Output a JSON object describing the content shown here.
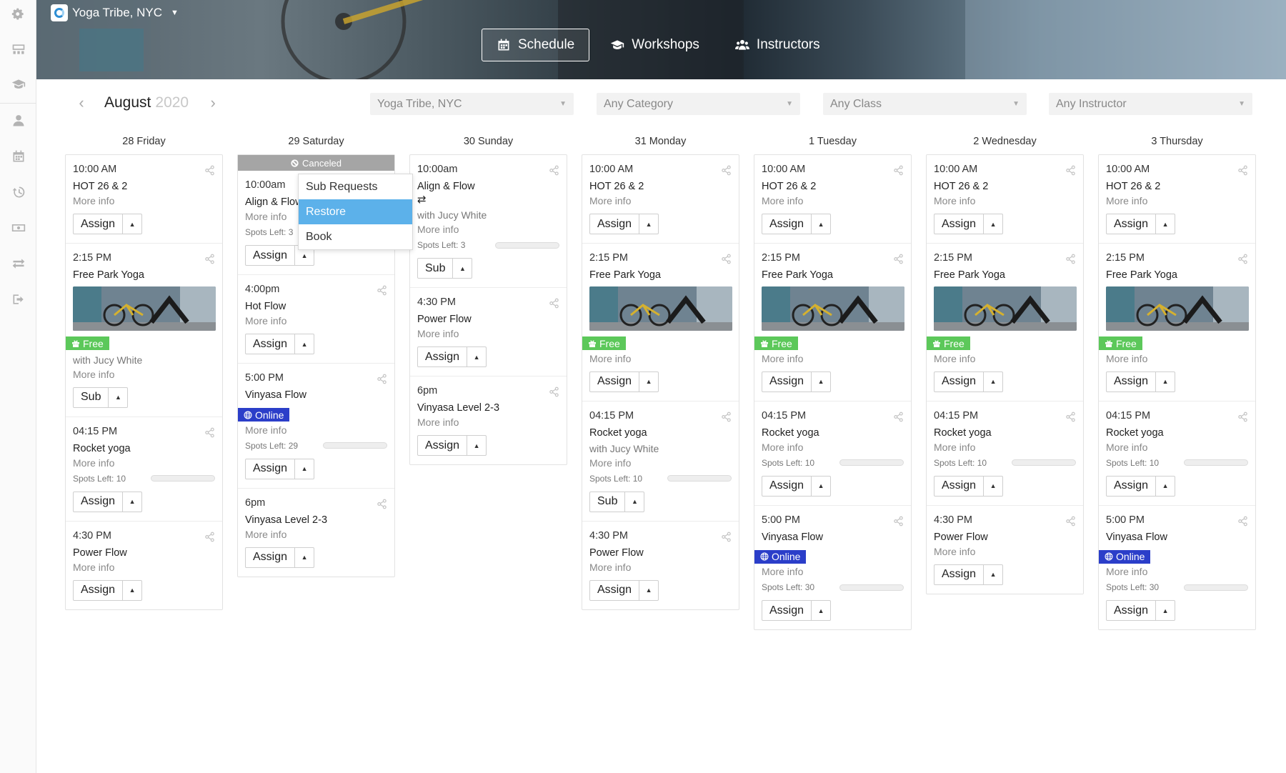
{
  "app": {
    "studio_name": "Yoga Tribe, NYC"
  },
  "nav": {
    "tabs": [
      {
        "label": "Schedule",
        "icon": "calendar-icon",
        "active": true
      },
      {
        "label": "Workshops",
        "icon": "graduation-cap-icon",
        "active": false
      },
      {
        "label": "Instructors",
        "icon": "users-icon",
        "active": false
      }
    ]
  },
  "sidebar": {
    "icons": [
      "settings-icon",
      "dashboard-icon",
      "graduation-cap-icon",
      "user-icon",
      "calendar-icon",
      "history-icon",
      "money-icon",
      "exchange-icon",
      "sign-out-icon"
    ]
  },
  "calendar": {
    "month": "August",
    "year": "2020"
  },
  "filters": {
    "location": "Yoga Tribe, NYC",
    "category": "Any Category",
    "class": "Any Class",
    "instructor": "Any Instructor"
  },
  "dropdown": {
    "items": [
      "Sub Requests",
      "Restore",
      "Book"
    ],
    "active_index": 1
  },
  "colors": {
    "free_badge": "#5cc85a",
    "online_badge": "#2b3ec9",
    "dropdown_active": "#5cb1ea",
    "canceled": "#a5a5a5"
  },
  "days": [
    {
      "label": "28 Friday",
      "canceled": null,
      "cards": [
        {
          "time": "10:00 AM",
          "name": "HOT 26 & 2",
          "more": "More info",
          "action": "Assign"
        },
        {
          "time": "2:15 PM",
          "name": "Free Park Yoga",
          "image": true,
          "badge": "Free",
          "badge_type": "free",
          "with": "with Jucy White",
          "more": "More info",
          "action": "Sub"
        },
        {
          "time": "04:15 PM",
          "name": "Rocket yoga",
          "more": "More info",
          "spots": "Spots Left: 10",
          "spots_fraction": 0.0,
          "action": "Assign"
        },
        {
          "time": "4:30 PM",
          "name": "Power Flow",
          "more": "More info",
          "action": "Assign"
        }
      ]
    },
    {
      "label": "29 Saturday",
      "canceled": "Canceled",
      "cards": [
        {
          "time": "10:00am",
          "name": "Align & Flow",
          "more": "More info",
          "spots": "Spots Left: 3",
          "spots_fraction": 0.0,
          "action": "Assign",
          "menu_open": true
        },
        {
          "time": "4:00pm",
          "name": "Hot Flow",
          "more": "More info",
          "action": "Assign"
        },
        {
          "time": "5:00 PM",
          "name": "Vinyasa Flow",
          "badge": "Online",
          "badge_type": "online",
          "more": "More info",
          "spots": "Spots Left: 29",
          "spots_fraction": 0.0,
          "action": "Assign"
        },
        {
          "time": "6pm",
          "name": "Vinyasa Level 2-3",
          "more": "More info",
          "action": "Assign"
        }
      ]
    },
    {
      "label": "30 Sunday",
      "canceled": null,
      "cards": [
        {
          "time": "10:00am",
          "name": "Align & Flow",
          "icon": "⇄",
          "with": "with Jucy White",
          "more": "More info",
          "spots": "Spots Left: 3",
          "spots_fraction": 0.0,
          "action": "Sub"
        },
        {
          "time": "4:30 PM",
          "name": "Power Flow",
          "more": "More info",
          "action": "Assign"
        },
        {
          "time": "6pm",
          "name": "Vinyasa Level 2-3",
          "more": "More info",
          "action": "Assign"
        }
      ]
    },
    {
      "label": "31 Monday",
      "canceled": null,
      "cards": [
        {
          "time": "10:00 AM",
          "name": "HOT 26 & 2",
          "more": "More info",
          "action": "Assign"
        },
        {
          "time": "2:15 PM",
          "name": "Free Park Yoga",
          "image": true,
          "badge": "Free",
          "badge_type": "free",
          "more": "More info",
          "action": "Assign"
        },
        {
          "time": "04:15 PM",
          "name": "Rocket yoga",
          "with": "with Jucy White",
          "more": "More info",
          "spots": "Spots Left: 10",
          "spots_fraction": 0.0,
          "action": "Sub"
        },
        {
          "time": "4:30 PM",
          "name": "Power Flow",
          "more": "More info",
          "action": "Assign"
        }
      ]
    },
    {
      "label": "1 Tuesday",
      "canceled": null,
      "cards": [
        {
          "time": "10:00 AM",
          "name": "HOT 26 & 2",
          "more": "More info",
          "action": "Assign"
        },
        {
          "time": "2:15 PM",
          "name": "Free Park Yoga",
          "image": true,
          "badge": "Free",
          "badge_type": "free",
          "more": "More info",
          "action": "Assign"
        },
        {
          "time": "04:15 PM",
          "name": "Rocket yoga",
          "more": "More info",
          "spots": "Spots Left: 10",
          "spots_fraction": 0.0,
          "action": "Assign"
        },
        {
          "time": "5:00 PM",
          "name": "Vinyasa Flow",
          "badge": "Online",
          "badge_type": "online",
          "more": "More info",
          "spots": "Spots Left: 30",
          "spots_fraction": 0.0,
          "action": "Assign"
        }
      ]
    },
    {
      "label": "2 Wednesday",
      "canceled": null,
      "cards": [
        {
          "time": "10:00 AM",
          "name": "HOT 26 & 2",
          "more": "More info",
          "action": "Assign"
        },
        {
          "time": "2:15 PM",
          "name": "Free Park Yoga",
          "image": true,
          "badge": "Free",
          "badge_type": "free",
          "more": "More info",
          "action": "Assign"
        },
        {
          "time": "04:15 PM",
          "name": "Rocket yoga",
          "more": "More info",
          "spots": "Spots Left: 10",
          "spots_fraction": 0.0,
          "action": "Assign"
        },
        {
          "time": "4:30 PM",
          "name": "Power Flow",
          "more": "More info",
          "action": "Assign"
        }
      ]
    },
    {
      "label": "3 Thursday",
      "canceled": null,
      "cards": [
        {
          "time": "10:00 AM",
          "name": "HOT 26 & 2",
          "more": "More info",
          "action": "Assign"
        },
        {
          "time": "2:15 PM",
          "name": "Free Park Yoga",
          "image": true,
          "badge": "Free",
          "badge_type": "free",
          "more": "More info",
          "action": "Assign"
        },
        {
          "time": "04:15 PM",
          "name": "Rocket yoga",
          "more": "More info",
          "spots": "Spots Left: 10",
          "spots_fraction": 0.0,
          "action": "Assign"
        },
        {
          "time": "5:00 PM",
          "name": "Vinyasa Flow",
          "badge": "Online",
          "badge_type": "online",
          "more": "More info",
          "spots": "Spots Left: 30",
          "spots_fraction": 0.0,
          "action": "Assign"
        }
      ]
    }
  ]
}
